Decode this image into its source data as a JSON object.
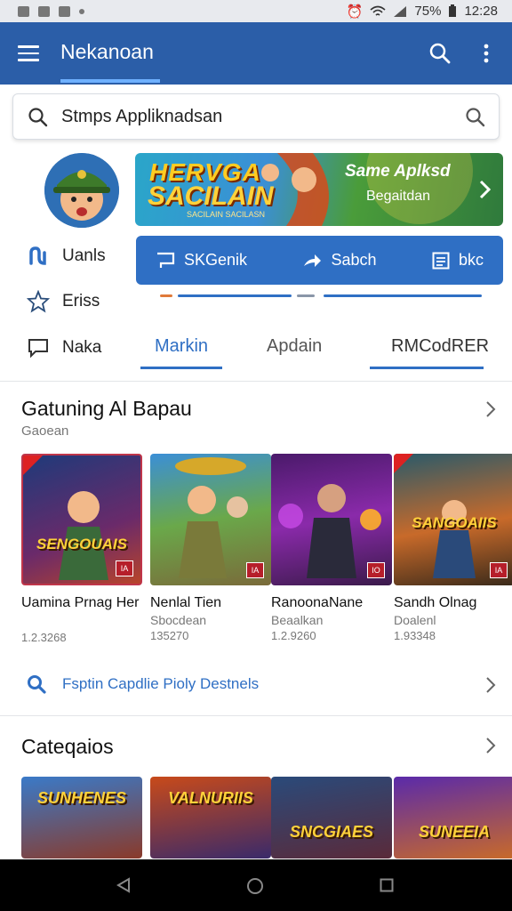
{
  "status": {
    "battery": "75%",
    "time": "12:28"
  },
  "appbar": {
    "title": "Nekanoan"
  },
  "search": {
    "text": "Stmps Appliknadsan"
  },
  "sidebar": {
    "items": [
      {
        "label": "Uanls"
      },
      {
        "label": "Eriss"
      },
      {
        "label": "Naka"
      }
    ]
  },
  "banner": {
    "line1": "HERVGA",
    "line2": "SACILAIN",
    "line3": "SACILAIN SACILASN",
    "title": "Same Aplksd",
    "subtitle": "Begaitdan"
  },
  "actions": [
    {
      "label": "SKGenik"
    },
    {
      "label": "Sabch"
    },
    {
      "label": "bkc"
    }
  ],
  "tabs": [
    {
      "label": "Markin"
    },
    {
      "label": "Apdain"
    },
    {
      "label": "RMCodRER"
    }
  ],
  "featured": {
    "title": "Gatuning Al Bapau",
    "subtitle": "Gaoean",
    "games": [
      {
        "art": "SENGOUAIS",
        "badge": "IA",
        "name": "Uamina Prnag Her",
        "sub": "",
        "count": "1.2.3268"
      },
      {
        "art": "",
        "badge": "IA",
        "name": "Nenlal Tien",
        "sub": "Sbocdean",
        "count": "135270"
      },
      {
        "art": "",
        "badge": "IO",
        "name": "RanoonaNane",
        "sub": "Beaalkan",
        "count": "1.2.9260"
      },
      {
        "art": "SANGOAIIS",
        "badge": "IA",
        "name": "Sandh Olnag",
        "sub": "Doalenl",
        "count": "1.93348"
      }
    ]
  },
  "link": {
    "label": "Fsptin Capdlie Pioly Destnels"
  },
  "categories": {
    "title": "Cateqaios",
    "items": [
      {
        "art": "SUNHENES"
      },
      {
        "art": "VALNURIIS"
      },
      {
        "art": "SNCGIAES"
      },
      {
        "art": "SUNEEIA"
      }
    ]
  },
  "colors": {
    "appbar": "#2b5ea8",
    "accent": "#2f6fc4"
  }
}
